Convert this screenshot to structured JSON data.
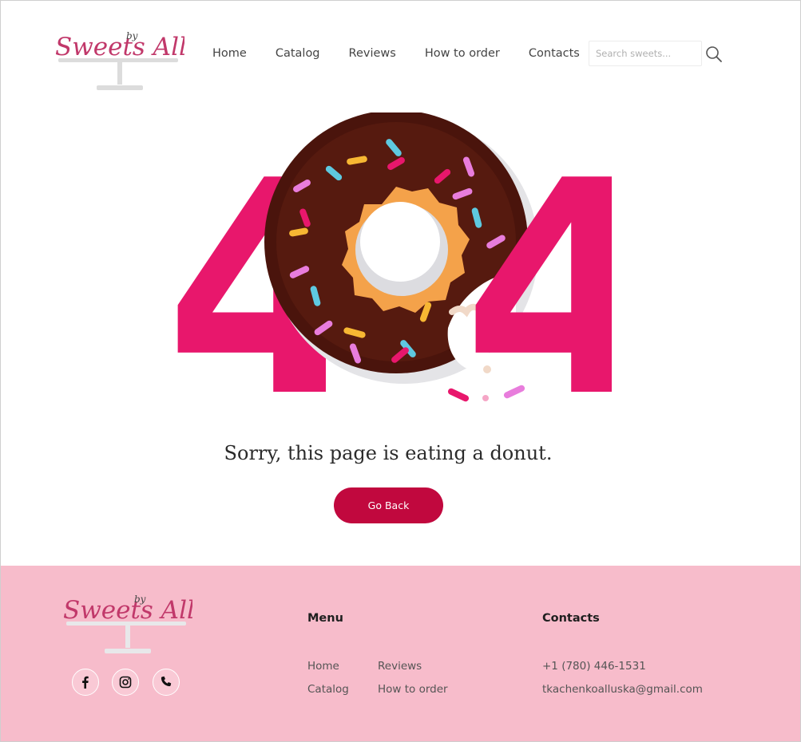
{
  "brand": {
    "logo_text": "Sweets Alla",
    "logo_by": "by"
  },
  "nav": {
    "items": [
      "Home",
      "Catalog",
      "Reviews",
      "How to order",
      "Contacts"
    ]
  },
  "search": {
    "placeholder": "Search sweets..."
  },
  "error": {
    "code_left": "4",
    "code_right": "4",
    "message": "Sorry, this page is eating a donut.",
    "button": "Go Back"
  },
  "footer": {
    "menu_title": "Menu",
    "menu_col1": [
      "Home",
      "Catalog"
    ],
    "menu_col2": [
      "Reviews",
      "How to order"
    ],
    "contacts_title": "Contacts",
    "phone": "+1 (780) 446-1531",
    "email": "tkachenkoalluska@gmail.com",
    "social_icons": [
      "facebook-icon",
      "instagram-icon",
      "phone-icon"
    ]
  },
  "colors": {
    "accent": "#c1083e",
    "pink_digit": "#e8176c",
    "footer_bg": "#f7bccb",
    "chocolate": "#4a140c"
  }
}
